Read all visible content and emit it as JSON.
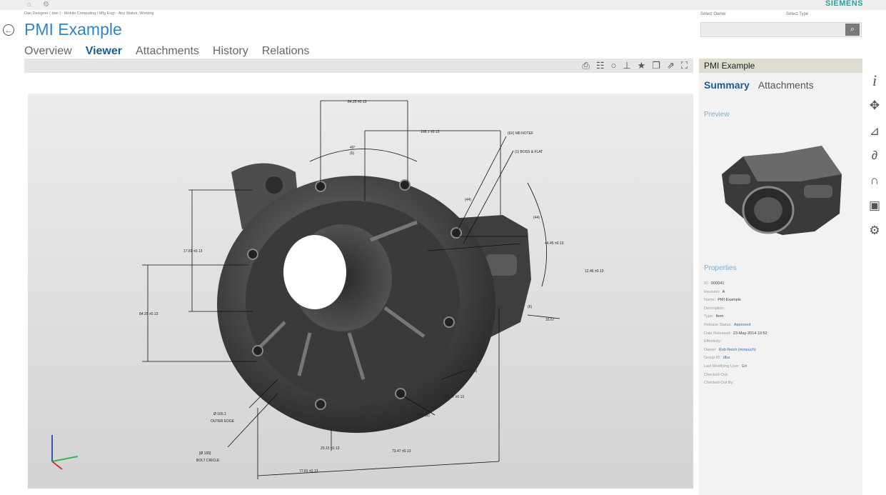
{
  "app": {
    "brand": "SIEMENS",
    "breadcrumb": "Dan Designer ( dan ) - Mobile Computing / Mfg Engr - Any Status; Working",
    "title": "PMI Example",
    "home_icon": "home-icon",
    "settings_icon": "gear-icon",
    "back_icon": "back-arrow-icon"
  },
  "tabs": [
    "Overview",
    "Viewer",
    "Attachments",
    "History",
    "Relations"
  ],
  "active_tab": "Viewer",
  "search": {
    "owner_label": "Select Owner",
    "type_label": "Select Type",
    "value": "",
    "button_icon": "search-icon"
  },
  "toolbar_icons": [
    "print-icon",
    "table-icon",
    "circle-icon",
    "pin-icon",
    "star-icon",
    "copy-icon",
    "share-icon",
    "fullscreen-icon"
  ],
  "viewer": {
    "triad_icon": "xyz-axes-icon",
    "annotations": [
      "84.25 ±0.13",
      "40°",
      "(6)",
      "108.1 ±0.13",
      "(6X) M8 NOTEF",
      "(1) BOSS & FLAT",
      "(44)",
      "(44)",
      "17.81 ±0.13",
      "44.45 ±0.13",
      "12.46 ±0.13",
      "84.25 ±0.13",
      "(6)",
      "16.67",
      "30.5 (6)",
      "108.27 ±0.13",
      "9.11 (6)",
      "Ø 165.1",
      "OUTER EDGE",
      "[Ø 165]",
      "BOLT CIRCLE",
      "20.15 ±0.13",
      "73.47 ±0.13",
      "77.81 ±0.13"
    ]
  },
  "panel": {
    "header": "PMI Example",
    "tabs": [
      "Summary",
      "Attachments"
    ],
    "active_tab": "Summary",
    "preview_label": "Preview",
    "properties_label": "Properties",
    "properties": [
      {
        "key": "ID:",
        "value": "000041",
        "link": false
      },
      {
        "key": "Revision:",
        "value": "A",
        "link": false
      },
      {
        "key": "Name:",
        "value": "PMI Example",
        "link": false
      },
      {
        "key": "Description:",
        "value": "",
        "link": false
      },
      {
        "key": "Type:",
        "value": "Item",
        "link": false
      },
      {
        "key": "Release Status:",
        "value": "Approved",
        "link": true
      },
      {
        "key": "Date Released:",
        "value": "23-May-2014 10:52",
        "link": false
      },
      {
        "key": "Effectivity:",
        "value": "",
        "link": false
      },
      {
        "key": "Owner:",
        "value": "Rob Reich (mmouch)",
        "link": true
      },
      {
        "key": "Group ID:",
        "value": "dba",
        "link": true
      },
      {
        "key": "Last Modifying User:",
        "value": "Ed",
        "link": true
      },
      {
        "key": "Checked-Out:",
        "value": "",
        "link": false
      },
      {
        "key": "Checked-Out By:",
        "value": "",
        "link": false
      }
    ]
  },
  "side_rail": [
    "info-icon",
    "move-icon",
    "measure-icon",
    "link-icon",
    "magnet-icon",
    "image-icon",
    "settings-icon"
  ]
}
